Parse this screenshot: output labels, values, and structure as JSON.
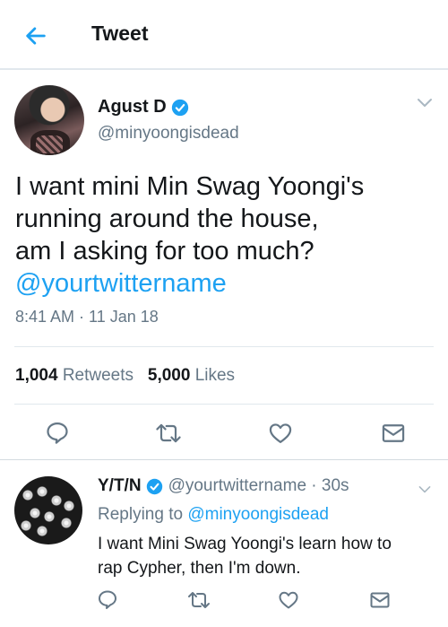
{
  "header": {
    "title": "Tweet"
  },
  "tweet": {
    "display_name": "Agust D",
    "handle": "@minyoongisdead",
    "text_lines": [
      "I want mini Min Swag Yoongi's",
      "running around the house,",
      "am I asking for too much?"
    ],
    "mention": "@yourtwittername",
    "timestamp": "8:41 AM · 11 Jan 18",
    "retweets_count": "1,004",
    "retweets_label": "Retweets",
    "likes_count": "5,000",
    "likes_label": "Likes"
  },
  "reply": {
    "display_name": "Y/T/N",
    "handle_time": "@yourtwittername · 30s",
    "replying_prefix": "Replying to",
    "replying_handle": "@minyoongisdead",
    "text_lines": [
      "I want Mini Swag Yoongi's learn how to",
      "rap Cypher, then I'm down."
    ]
  },
  "icons": {
    "back": "arrow-left-icon",
    "verified": "verified-badge-icon",
    "caret": "chevron-down-icon",
    "reply": "speech-bubble-icon",
    "retweet": "retweet-icon",
    "like": "heart-icon",
    "message": "envelope-icon"
  },
  "colors": {
    "accent": "#1da1f2",
    "secondary_text": "#657786",
    "border": "#e1e8ed"
  }
}
